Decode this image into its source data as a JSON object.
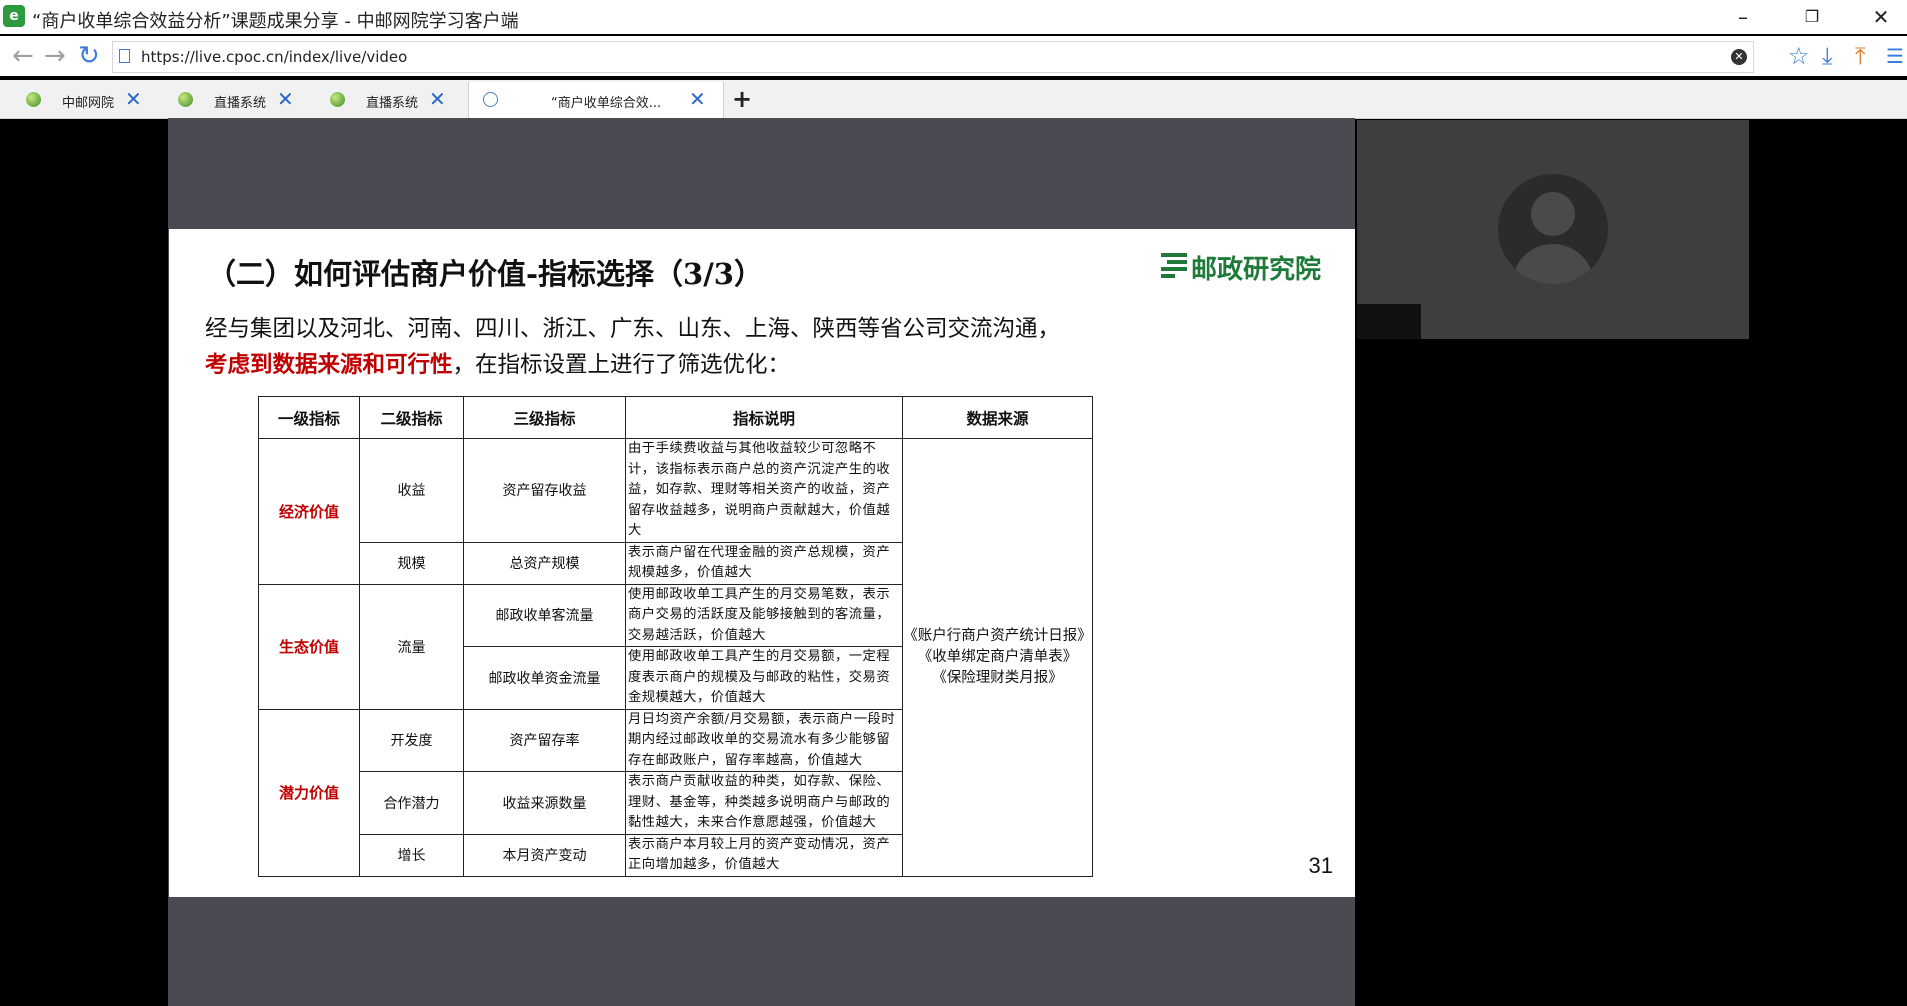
{
  "window": {
    "title": "“商户收单综合效益分析”课题成果分享 - 中邮网院学习客户端",
    "app_icon": "app-logo-icon",
    "min": "–",
    "restore": "❐",
    "close": "✕"
  },
  "address_bar": {
    "url": "https://live.cpoc.cn/index/live/video",
    "back": "←",
    "forward": "→",
    "reload": "↻",
    "clear": "✕",
    "favorite": "☆",
    "download": "⤓",
    "share": "⤒",
    "menu": "☰"
  },
  "tabs": [
    {
      "label": "中邮网院",
      "close": "✕"
    },
    {
      "label": "直播系统",
      "close": "✕"
    },
    {
      "label": "直播系统",
      "close": "✕"
    },
    {
      "label": "“商户收单综合效...",
      "close": "✕"
    }
  ],
  "new_tab": "+",
  "slide": {
    "title": "（二）如何评估商户价值-指标选择（3/3）",
    "logo_text": "邮政研究院",
    "intro_line1": "经与集团以及河北、河南、四川、浙江、广东、山东、上海、陕西等省公司交流沟通，",
    "intro_red": "考虑到数据来源和可行性",
    "intro_rest": "，在指标设置上进行了筛选优化：",
    "headers": [
      "一级指标",
      "二级指标",
      "三级指标",
      "指标说明",
      "数据来源"
    ],
    "groups": [
      "经济价值",
      "生态价值",
      "潜力价值"
    ],
    "level2": [
      "收益",
      "规模",
      "流量",
      "开发度",
      "合作潜力",
      "增长"
    ],
    "rows": [
      {
        "l3": "资产留存收益",
        "desc": "由于手续费收益与其他收益较少可忽略不计，该指标表示商户总的资产沉淀产生的收益，如存款、理财等相关资产的收益，资产留存收益越多，说明商户贡献越大，价值越大"
      },
      {
        "l3": "总资产规模",
        "desc": "表示商户留在代理金融的资产总规模，资产规模越多，价值越大"
      },
      {
        "l3": "邮政收单客流量",
        "desc": "使用邮政收单工具产生的月交易笔数，表示商户交易的活跃度及能够接触到的客流量，交易越活跃，价值越大"
      },
      {
        "l3": "邮政收单资金流量",
        "desc": "使用邮政收单工具产生的月交易额，一定程度表示商户的规模及与邮政的粘性，交易资金规模越大，价值越大"
      },
      {
        "l3": "资产留存率",
        "desc": "月日均资产余额/月交易额，表示商户一段时期内经过邮政收单的交易流水有多少能够留存在邮政账户，留存率越高，价值越大"
      },
      {
        "l3": "收益来源数量",
        "desc": "表示商户贡献收益的种类，如存款、保险、理财、基金等，种类越多说明商户与邮政的黏性越大，未来合作意愿越强，价值越大"
      },
      {
        "l3": "本月资产变动",
        "desc": "表示商户本月较上月的资产变动情况，资产正向增加越多，价值越大"
      }
    ],
    "sources": [
      "《账户行商户资产统计日报》",
      "《收单绑定商户清单表》",
      "《保险理财类月报》"
    ],
    "page_number": "31"
  }
}
